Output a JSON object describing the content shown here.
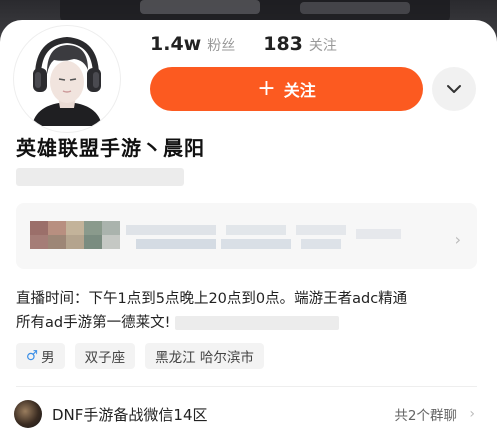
{
  "profile": {
    "fans_count": "1.4w",
    "fans_label": "粉丝",
    "following_count": "183",
    "following_label": "关注",
    "follow_button_label": "关注",
    "name": "英雄联盟手游丶晨阳",
    "bio_line1": "直播时间：下午1点到5点晚上20点到0点。端游王者adc精通",
    "bio_line2": "所有ad手游第一德莱文!"
  },
  "tags": [
    {
      "label": "男",
      "icon": "male-icon"
    },
    {
      "label": "双子座"
    },
    {
      "label": "黑龙江 哈尔滨市"
    }
  ],
  "group": {
    "name": "DNF手游备战微信14区",
    "count_label": "共2个群聊"
  },
  "colors": {
    "accent": "#fc5a20",
    "male": "#3a8ee6"
  }
}
